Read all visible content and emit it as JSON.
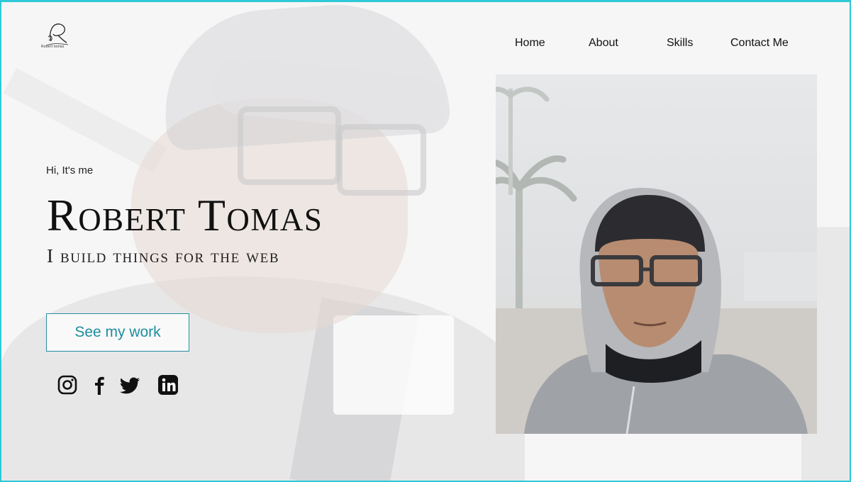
{
  "logo": {
    "caption": "Robert tomas"
  },
  "nav": [
    {
      "label": "Home"
    },
    {
      "label": "About"
    },
    {
      "label": "Skills"
    },
    {
      "label": "Contact Me"
    }
  ],
  "hero": {
    "greeting": "Hi, It's me",
    "name": "Robert Tomas",
    "tagline": "I build things for the web",
    "cta_label": "See my work"
  },
  "social": [
    {
      "icon": "instagram-icon"
    },
    {
      "icon": "facebook-icon"
    },
    {
      "icon": "twitter-icon"
    },
    {
      "icon": "linkedin-icon"
    }
  ],
  "colors": {
    "accent": "#1e8d9f",
    "frame": "#2ec9d8"
  }
}
